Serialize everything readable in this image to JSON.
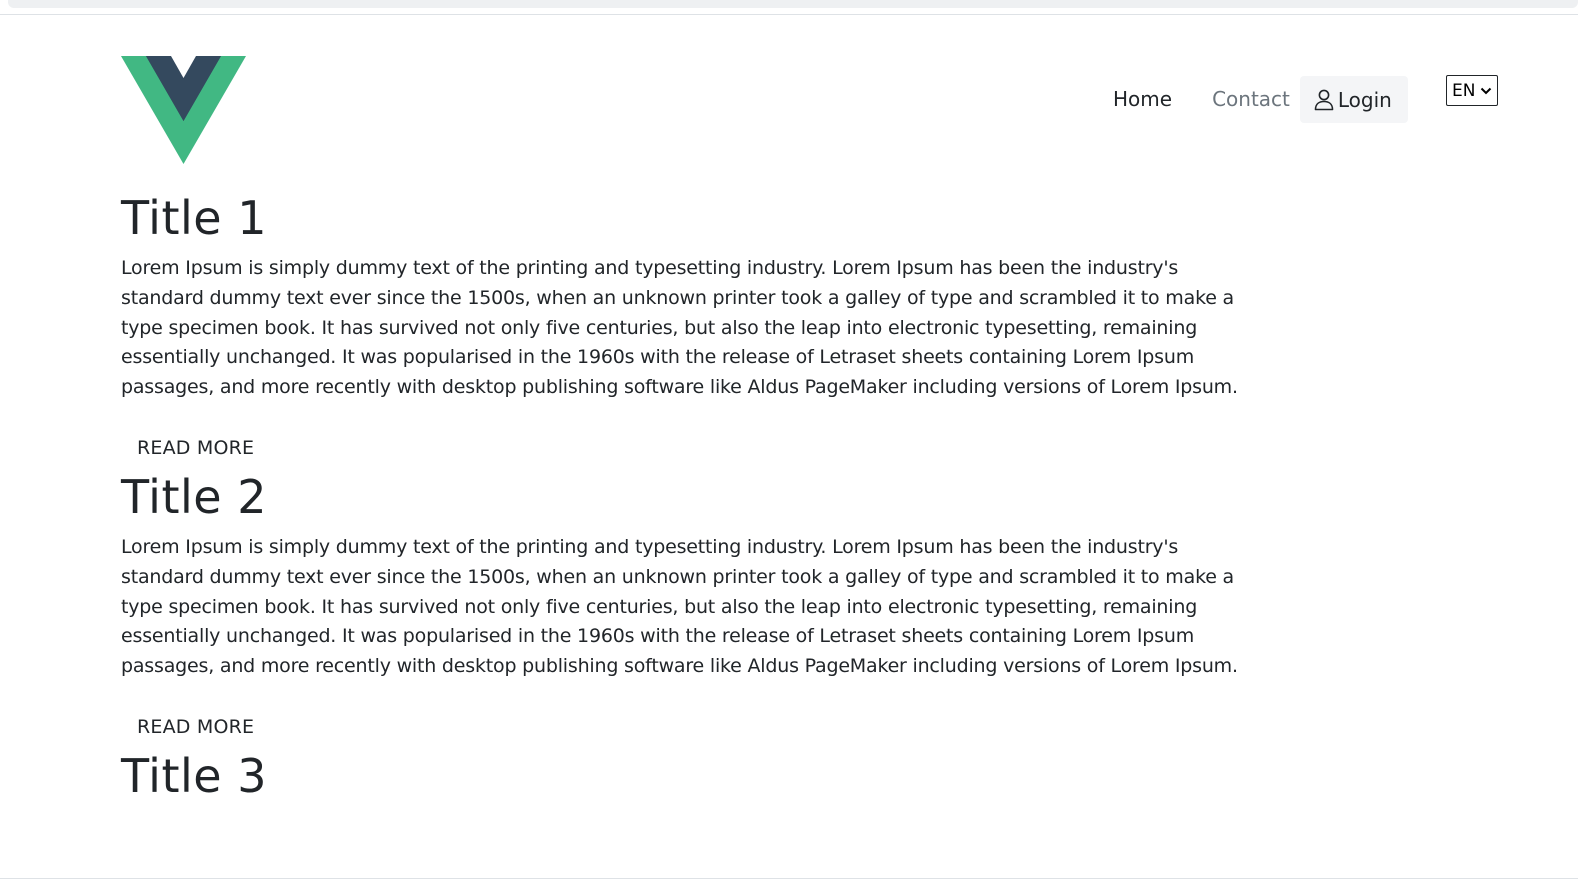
{
  "header": {
    "nav": {
      "home": "Home",
      "contact": "Contact",
      "login": "Login"
    },
    "language": "EN"
  },
  "articles": [
    {
      "title": "Title 1",
      "body": "Lorem Ipsum is simply dummy text of the printing and typesetting industry. Lorem Ipsum has been the industry's standard dummy text ever since the 1500s, when an unknown printer took a galley of type and scrambled it to make a type specimen book. It has survived not only five centuries, but also the leap into electronic typesetting, remaining essentially unchanged. It was popularised in the 1960s with the release of Letraset sheets containing Lorem Ipsum passages, and more recently with desktop publishing software like Aldus PageMaker including versions of Lorem Ipsum.",
      "read_more": "READ MORE"
    },
    {
      "title": "Title 2",
      "body": "Lorem Ipsum is simply dummy text of the printing and typesetting industry. Lorem Ipsum has been the industry's standard dummy text ever since the 1500s, when an unknown printer took a galley of type and scrambled it to make a type specimen book. It has survived not only five centuries, but also the leap into electronic typesetting, remaining essentially unchanged. It was popularised in the 1960s with the release of Letraset sheets containing Lorem Ipsum passages, and more recently with desktop publishing software like Aldus PageMaker including versions of Lorem Ipsum.",
      "read_more": "READ MORE"
    },
    {
      "title": "Title 3"
    }
  ],
  "icons": {
    "logo": "vue-logo-icon",
    "login": "user-icon",
    "language": "chevron-down-icon"
  },
  "colors": {
    "logo_outer": "#41b883",
    "logo_inner": "#34495e",
    "text": "#212529",
    "nav_muted": "#6c757d",
    "login_bg": "#f4f5f7"
  }
}
